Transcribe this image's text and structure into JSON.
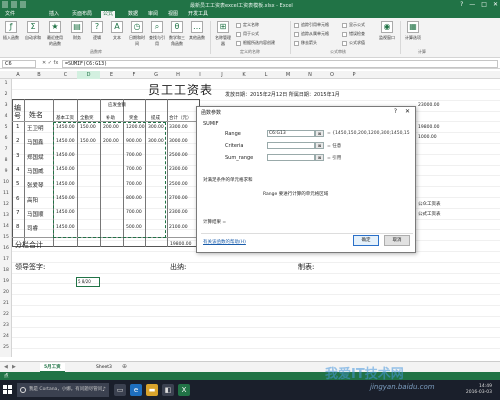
{
  "window": {
    "title": "最新员工工资表excel工资表模板.xlsx - Excel",
    "controls": [
      "?",
      "—",
      "□",
      "✕"
    ]
  },
  "ribbon_tabs": [
    "文件",
    "插入",
    "页面布局",
    "公式",
    "数据",
    "审阅",
    "视图",
    "开发工具"
  ],
  "active_tab": "公式",
  "ribbon": {
    "insert_function": "插入函数",
    "autosum": "自动求和",
    "recent": "最近使用的函数",
    "financial": "财务",
    "logical": "逻辑",
    "text": "文本",
    "datetime": "日期和时间",
    "lookup": "查找与引用",
    "math": "数学和三角函数",
    "more": "其他函数",
    "name_manager": "名称管理器",
    "define_name": "定义名称",
    "use_in_formula": "用于公式",
    "create_from_selection": "根据所选内容创建",
    "trace_precedents": "追踪引用单元格",
    "trace_dependents": "追踪从属单元格",
    "remove_arrows": "移去箭头",
    "show_formulas": "显示公式",
    "error_checking": "错误检查",
    "evaluate": "公式求值",
    "watch_window": "监视窗口",
    "calc_options": "计算选项",
    "calculation_group": "计算",
    "group_library": "函数库",
    "group_names": "定义的名称",
    "group_audit": "公式审核"
  },
  "formula_bar": {
    "name_box": "C6",
    "fx": "✕ ✓ fx",
    "formula": "=SUMIF(C6:G13)"
  },
  "columns": [
    "A",
    "B",
    "C",
    "D",
    "E",
    "F",
    "G",
    "H",
    "I",
    "J",
    "K",
    "L",
    "M",
    "N",
    "O",
    "P"
  ],
  "rows": [
    "1",
    "2",
    "3",
    "4",
    "5",
    "6",
    "7",
    "8",
    "9",
    "10",
    "11",
    "12",
    "13",
    "14",
    "15",
    "16",
    "17",
    "18",
    "19",
    "20",
    "21",
    "22",
    "23",
    "24",
    "25"
  ],
  "sheet": {
    "title": "员工工资表",
    "issue_date": "发放日期：2015年2月12日 所属日期：2015年1月",
    "hdr_no": "编号",
    "hdr_name": "姓名",
    "hdr_group": "应发金额",
    "subheaders": [
      "基本工资",
      "全勤奖",
      "补助",
      "奖金",
      "提成",
      "合计（元）"
    ],
    "employees": [
      {
        "no": "1",
        "name": "王卫明",
        "vals": [
          "1450.00",
          "150.00",
          "200.00",
          "1200.00",
          "300.00",
          "3300.00"
        ]
      },
      {
        "no": "2",
        "name": "马国鑫",
        "vals": [
          "1450.00",
          "150.00",
          "200.00",
          "900.00",
          "300.00",
          "3000.00"
        ]
      },
      {
        "no": "3",
        "name": "郑国斌",
        "vals": [
          "1450.00",
          "",
          "",
          "700.00",
          "",
          "2500.00"
        ]
      },
      {
        "no": "4",
        "name": "马国威",
        "vals": [
          "1450.00",
          "",
          "",
          "700.00",
          "",
          "2300.00"
        ]
      },
      {
        "no": "5",
        "name": "张爱琴",
        "vals": [
          "1450.00",
          "",
          "",
          "700.00",
          "",
          "2500.00"
        ]
      },
      {
        "no": "6",
        "name": "高阳",
        "vals": [
          "1450.00",
          "",
          "",
          "800.00",
          "",
          "2700.00"
        ]
      },
      {
        "no": "7",
        "name": "马国顺",
        "vals": [
          "1450.00",
          "",
          "",
          "700.00",
          "",
          "2300.00"
        ]
      },
      {
        "no": "8",
        "name": "司睿",
        "vals": [
          "1450.00",
          "",
          "",
          "500.00",
          "",
          "2100.00"
        ]
      }
    ],
    "subtotal_label": "分栏合计",
    "subtotal_value": "19800.00",
    "sign_leader": "领导签字:",
    "sign_cashier": "出纳:",
    "sign_maker": "制表:",
    "selected_cell_text": "5 8/20"
  },
  "dialog": {
    "title": "函数参数",
    "help": "?",
    "close": "✕",
    "function_name": "SUMIF",
    "args": [
      {
        "label": "Range",
        "value": "C6:G13",
        "result": "= {1450,150,200,1200,300;1450,15"
      },
      {
        "label": "Criteria",
        "value": "",
        "result": "= 任意"
      },
      {
        "label": "Sum_range",
        "value": "",
        "result": "= 引用"
      }
    ],
    "ref_button": "⊠",
    "description": "对满足条件的单元格求和",
    "detail": "Range  要进行计算的单元格区域",
    "result_label": "计算结果 =",
    "help_link": "有关该函数的帮助(H)",
    "ok": "确定",
    "cancel": "取消"
  },
  "side_panel": [
    "23000.00",
    "19800.00",
    "1000.00",
    "公众工资表",
    "公式工资表"
  ],
  "sheet_tabs": [
    "5月工资",
    "Sheet3"
  ],
  "active_sheet": "5月工资",
  "nav_arrows": [
    "◀",
    "▶"
  ],
  "add_sheet": "⊕",
  "status_text": "点",
  "taskbar": {
    "search_placeholder": "我是 Cortana，小娜。有问题尽管问我。",
    "clock_time": "14:49",
    "clock_date": "2016-03-03"
  },
  "watermark": {
    "main": "我爱IT技术网",
    "sub": "jingyan.baidu.com"
  },
  "colors": {
    "excel_green": "#217346",
    "taskbar": "#1a1f2b",
    "link": "#1a5dab"
  }
}
